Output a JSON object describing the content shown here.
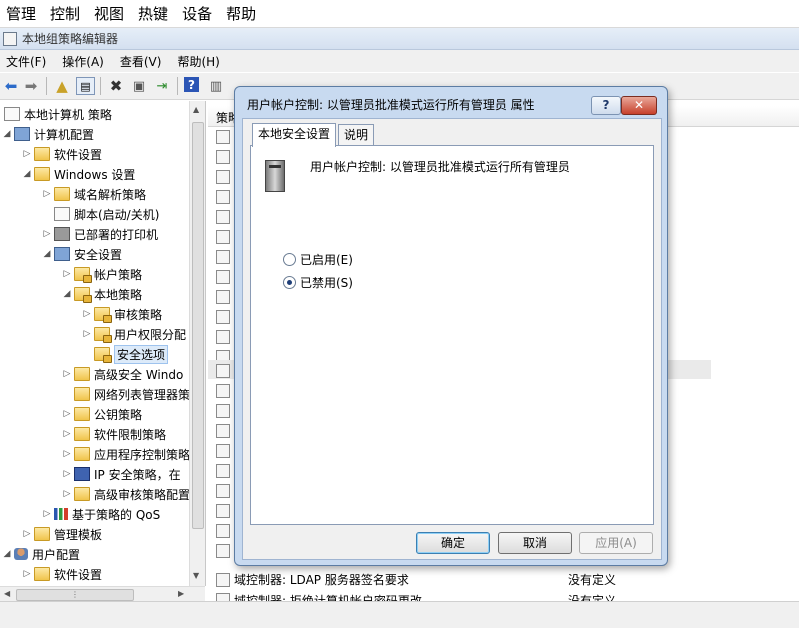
{
  "host_menu": [
    "管理",
    "控制",
    "视图",
    "热键",
    "设备",
    "帮助"
  ],
  "window": {
    "title": "本地组策略编辑器"
  },
  "menubar": [
    "文件(F)",
    "操作(A)",
    "查看(V)",
    "帮助(H)"
  ],
  "tree": {
    "items": [
      {
        "label": "本地计算机 策略"
      },
      {
        "label": "计算机配置"
      },
      {
        "label": "软件设置"
      },
      {
        "label": "Windows 设置"
      },
      {
        "label": "域名解析策略"
      },
      {
        "label": "脚本(启动/关机)"
      },
      {
        "label": "已部署的打印机"
      },
      {
        "label": "安全设置"
      },
      {
        "label": "帐户策略"
      },
      {
        "label": "本地策略"
      },
      {
        "label": "审核策略"
      },
      {
        "label": "用户权限分配"
      },
      {
        "label": "安全选项"
      },
      {
        "label": "高级安全 Windo"
      },
      {
        "label": "网络列表管理器策"
      },
      {
        "label": "公钥策略"
      },
      {
        "label": "软件限制策略"
      },
      {
        "label": "应用程序控制策略"
      },
      {
        "label": "IP 安全策略，在"
      },
      {
        "label": "高级审核策略配置"
      },
      {
        "label": "基于策略的 QoS"
      },
      {
        "label": "管理模板"
      },
      {
        "label": "用户配置"
      },
      {
        "label": "软件设置"
      }
    ]
  },
  "list": {
    "header": "策略",
    "rows": [
      {
        "name": "域控制器: LDAP 服务器签名要求",
        "value": "没有定义"
      },
      {
        "name": "域控制器: 拒绝计算机帐户密码更改",
        "value": "没有定义"
      }
    ]
  },
  "dialog": {
    "title": "用户帐户控制: 以管理员批准模式运行所有管理员 属性",
    "help_label": "?",
    "close_label": "✕",
    "tabs": [
      "本地安全设置",
      "说明"
    ],
    "policy_name": "用户帐户控制: 以管理员批准模式运行所有管理员",
    "options": [
      {
        "label": "已启用(E)",
        "checked": false
      },
      {
        "label": "已禁用(S)",
        "checked": true
      }
    ],
    "buttons": {
      "ok": "确定",
      "cancel": "取消",
      "apply": "应用(A)"
    }
  }
}
